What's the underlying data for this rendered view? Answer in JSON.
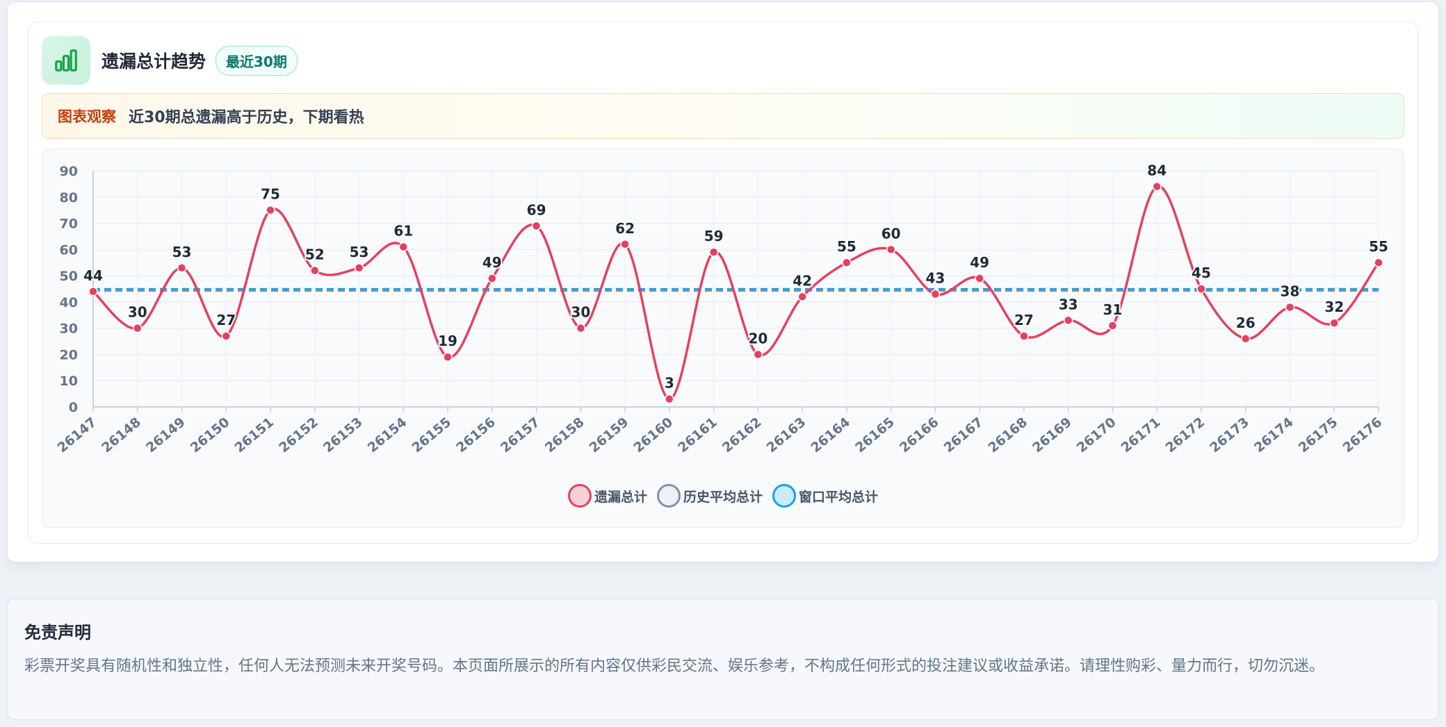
{
  "header": {
    "title": "遗漏总计趋势",
    "badge": "最近30期",
    "icon": "bar-chart-icon",
    "icon_color": "#16a34a"
  },
  "observation": {
    "label": "图表观察",
    "text": "近30期总遗漏高于历史，下期看热"
  },
  "chart_data": {
    "type": "line",
    "title": "",
    "xlabel": "",
    "ylabel": "",
    "ylim": [
      0,
      90
    ],
    "yticks": [
      0,
      10,
      20,
      30,
      40,
      50,
      60,
      70,
      80,
      90
    ],
    "grid": true,
    "legend_position": "bottom",
    "categories": [
      "26147",
      "26148",
      "26149",
      "26150",
      "26151",
      "26152",
      "26153",
      "26154",
      "26155",
      "26156",
      "26157",
      "26158",
      "26159",
      "26160",
      "26161",
      "26162",
      "26163",
      "26164",
      "26165",
      "26166",
      "26167",
      "26168",
      "26169",
      "26170",
      "26171",
      "26172",
      "26173",
      "26174",
      "26175",
      "26176"
    ],
    "series": [
      {
        "name": "遗漏总计",
        "style": "smooth line with markers and data labels",
        "color": "#e5405e",
        "fill": "#f9d0d8",
        "values": [
          44,
          30,
          53,
          27,
          75,
          52,
          53,
          61,
          19,
          49,
          69,
          30,
          62,
          3,
          59,
          20,
          42,
          55,
          60,
          43,
          49,
          27,
          33,
          31,
          84,
          45,
          26,
          38,
          32,
          55
        ]
      },
      {
        "name": "历史平均总计",
        "style": "dashed line",
        "color": "#8290a8",
        "fill": "#eef1f5",
        "value": 44.3
      },
      {
        "name": "窗口平均总计",
        "style": "dashed line",
        "color": "#0ea5e9",
        "fill": "#cdeaf8",
        "value": 44.9
      }
    ]
  },
  "disclaimer": {
    "title": "免责声明",
    "text": "彩票开奖具有随机性和独立性，任何人无法预测未来开奖号码。本页面所展示的所有内容仅供彩民交流、娱乐参考，不构成任何形式的投注建议或收益承诺。请理性购彩、量力而行，切勿沉迷。"
  }
}
